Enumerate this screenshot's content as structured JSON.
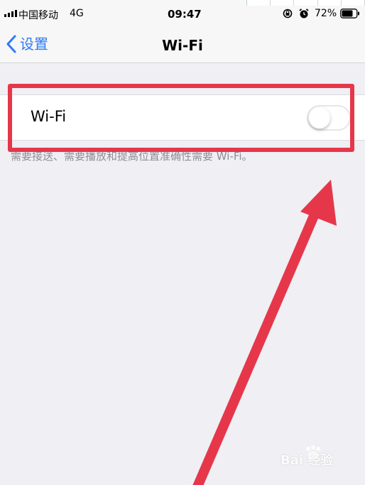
{
  "status_bar": {
    "carrier": "中国移动",
    "network": "4G",
    "time": "09:47",
    "battery": "72%",
    "icons": [
      "signal-icon",
      "orientation-lock-icon",
      "alarm-icon",
      "battery-icon"
    ]
  },
  "nav": {
    "back_label": "设置",
    "title": "Wi-Fi"
  },
  "wifi": {
    "label": "Wi-Fi",
    "toggle_state": "off",
    "footer": "需要接送、需要播放和提高位置准确性需要 Wi-Fi。"
  },
  "overlay": {
    "watermark": "Bai 经验"
  },
  "colors": {
    "accent": "#2f7bf5",
    "highlight": "#e6374a",
    "background": "#efeff4"
  }
}
